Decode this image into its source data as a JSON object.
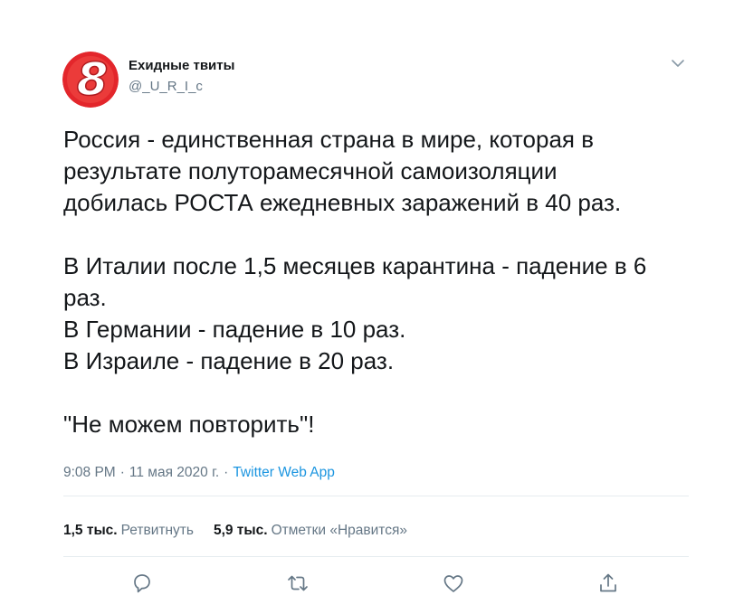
{
  "author": {
    "name": "Exидные твиты",
    "handle": "@_U_R_I_c",
    "avatar_icon": "channel-8-logo",
    "avatar_text": "8"
  },
  "tweet": {
    "text": "Россия - единственная страна в мире, которая в\nрезультате полуторамесячной самоизоляции\nдобилась РОСТА ежедневных заражений в 40 раз.\n\nВ Италии после 1,5 месяцев карантина - падение в 6\nраз.\nВ Германии - падение в 10 раз.\nВ Израиле - падение в 20 раз.\n\n\"Не можем повторить\"!",
    "time": "9:08 PM",
    "date": "11 мая 2020 г.",
    "separator": "·",
    "source": "Twitter Web App"
  },
  "stats": {
    "retweets_count": "1,5 тыс.",
    "retweets_label": "Ретвитнуть",
    "likes_count": "5,9 тыс.",
    "likes_label": "Отметки «Нравится»"
  },
  "actions": [
    {
      "name": "reply-icon"
    },
    {
      "name": "retweet-icon"
    },
    {
      "name": "like-icon"
    },
    {
      "name": "share-icon"
    }
  ],
  "colors": {
    "text": "#14171a",
    "secondary": "#657786",
    "link": "#1b95e0",
    "divider": "#e6ecf0",
    "avatar_red": "#e3262b"
  }
}
